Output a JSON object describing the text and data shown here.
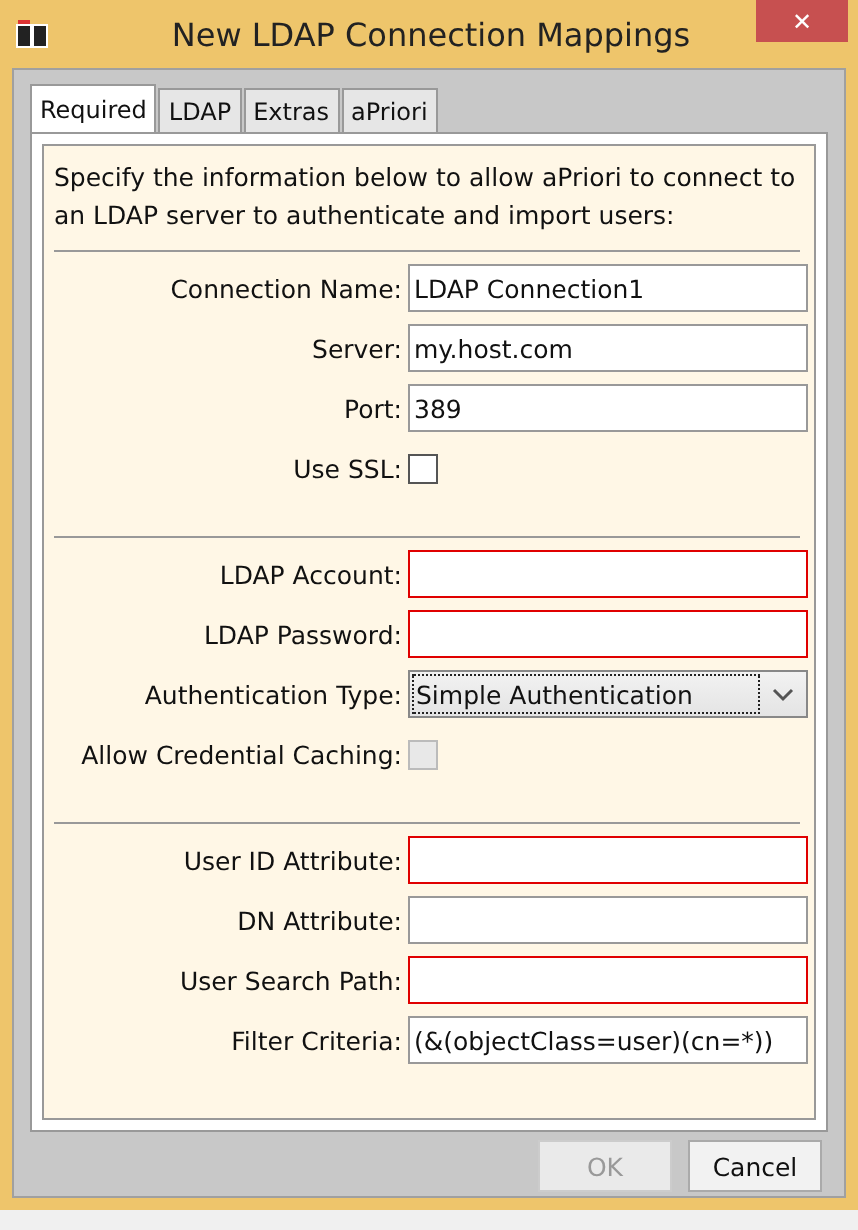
{
  "window": {
    "title": "New LDAP Connection Mappings",
    "close": "✕"
  },
  "tabs": [
    {
      "label": "Required",
      "selected": true
    },
    {
      "label": "LDAP",
      "selected": false
    },
    {
      "label": "Extras",
      "selected": false
    },
    {
      "label": "aPriori",
      "selected": false
    }
  ],
  "intro": "Specify the information below to allow aPriori to connect to an LDAP server to authenticate and import users:",
  "sections": [
    {
      "fields": [
        {
          "kind": "text",
          "label": "Connection Name:",
          "value": "LDAP Connection1",
          "required": false
        },
        {
          "kind": "text",
          "label": "Server:",
          "value": "my.host.com",
          "required": false
        },
        {
          "kind": "text",
          "label": "Port:",
          "value": "389",
          "required": false
        },
        {
          "kind": "checkbox",
          "label": "Use SSL:",
          "checked": false,
          "disabled": false
        }
      ]
    },
    {
      "fields": [
        {
          "kind": "text",
          "label": "LDAP Account:",
          "required": true
        },
        {
          "kind": "text",
          "label": "LDAP Password:",
          "required": true
        },
        {
          "kind": "select",
          "label": "Authentication Type:",
          "value": "Simple Authentication",
          "focused": true
        },
        {
          "kind": "checkbox",
          "label": "Allow Credential Caching:",
          "checked": false,
          "disabled": true
        }
      ]
    },
    {
      "fields": [
        {
          "kind": "text",
          "label": "User ID Attribute:",
          "required": true
        },
        {
          "kind": "text",
          "label": "DN Attribute:",
          "required": false
        },
        {
          "kind": "text",
          "label": "User Search Path:",
          "required": true
        },
        {
          "kind": "text",
          "label": "Filter Criteria:",
          "value": "(&(objectClass=user)(cn=*))",
          "required": false
        }
      ]
    }
  ],
  "buttons": [
    {
      "label": "OK",
      "disabled": true
    },
    {
      "label": "Cancel",
      "disabled": false
    }
  ]
}
